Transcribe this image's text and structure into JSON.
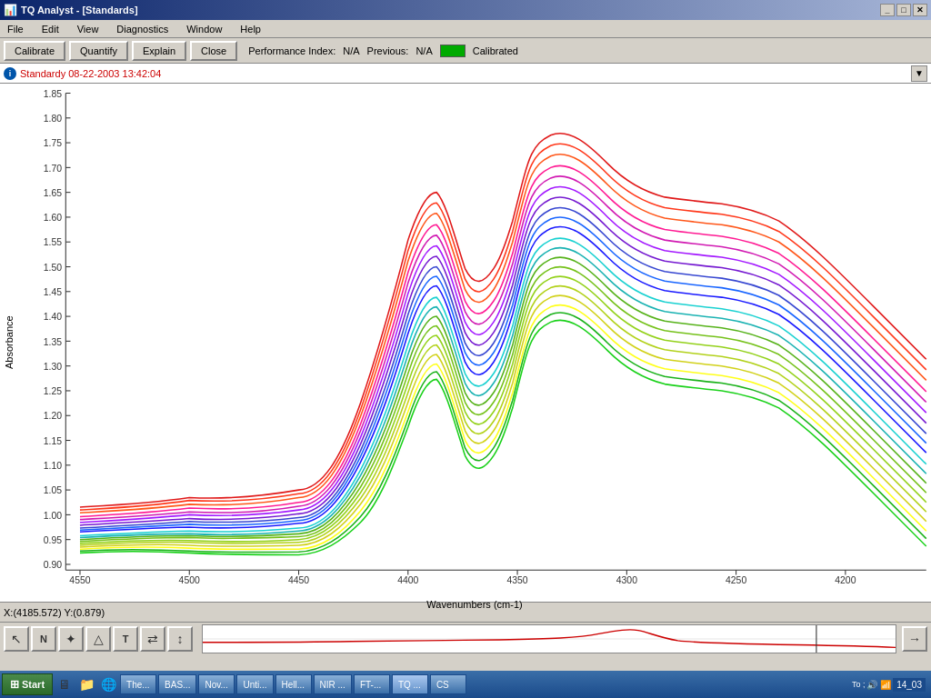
{
  "title_bar": {
    "title": "TQ Analyst - [Standards]",
    "minimize_label": "_",
    "maximize_label": "□",
    "close_label": "✕",
    "inner_minimize": "_",
    "inner_maximize": "□",
    "inner_close": "✕"
  },
  "menu_bar": {
    "items": [
      "File",
      "Edit",
      "View",
      "Diagnostics",
      "Window",
      "Help"
    ]
  },
  "toolbar": {
    "calibrate": "Calibrate",
    "quantify": "Quantify",
    "explain": "Explain",
    "close": "Close",
    "performance_label": "Performance Index:",
    "performance_value": "N/A",
    "previous_label": "Previous:",
    "previous_value": "N/A",
    "calibrated_label": "Calibrated"
  },
  "info_bar": {
    "icon": "i",
    "text": "Standardy 08-22-2003 13:42:04",
    "download_icon": "▼"
  },
  "chart": {
    "y_axis_label": "Absorbance",
    "x_axis_label": "Wavenumbers (cm-1)",
    "y_ticks": [
      "1.85",
      "1.80",
      "1.75",
      "1.70",
      "1.65",
      "1.60",
      "1.55",
      "1.50",
      "1.45",
      "1.40",
      "1.35",
      "1.30",
      "1.25",
      "1.20",
      "1.15",
      "1.10",
      "1.05",
      "1.00",
      "0.95",
      "0.90"
    ],
    "x_ticks": [
      "4550",
      "4500",
      "4450",
      "4400",
      "4350",
      "4300",
      "4250",
      "4200"
    ]
  },
  "coord_bar": {
    "text": "X:(4185.572) Y:(0.879)"
  },
  "tool_buttons": [
    "↖",
    "N",
    "★",
    "△",
    "T",
    "⇄",
    "↕"
  ],
  "taskbar": {
    "start": "Start",
    "items": [
      "The...",
      "BAS...",
      "Nov...",
      "Unti...",
      "Hell...",
      "NIR ...",
      "FT-...",
      "TQ ...",
      "CS"
    ],
    "time": "14_03",
    "to_label": "To ;"
  }
}
